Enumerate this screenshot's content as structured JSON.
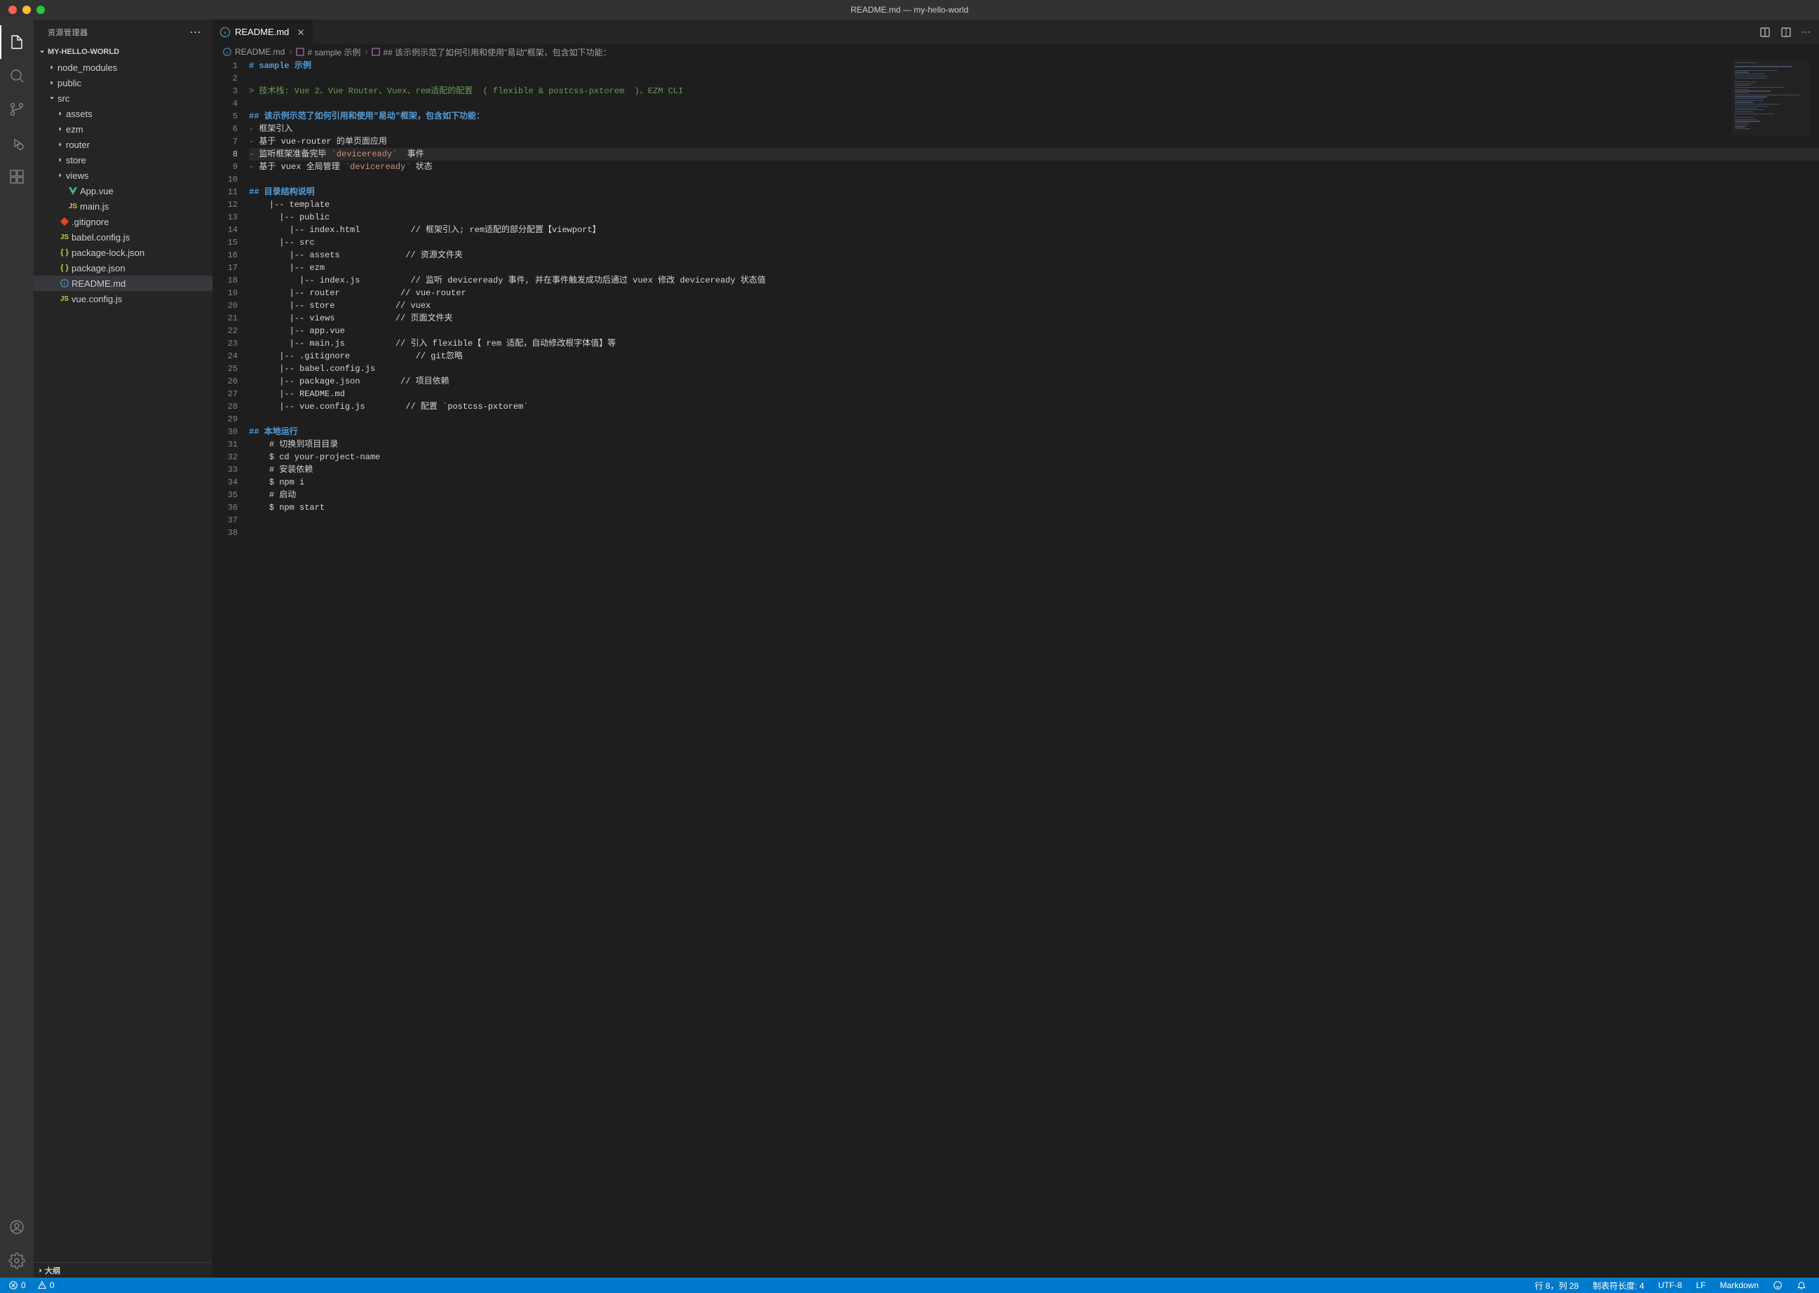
{
  "titlebar": {
    "title": "README.md — my-hello-world"
  },
  "sidebar": {
    "title": "资源管理器",
    "project": "MY-HELLO-WORLD",
    "outline": "大纲",
    "tree": [
      {
        "name": "node_modules",
        "type": "folder",
        "depth": 1,
        "expanded": false
      },
      {
        "name": "public",
        "type": "folder",
        "depth": 1,
        "expanded": false
      },
      {
        "name": "src",
        "type": "folder",
        "depth": 1,
        "expanded": true
      },
      {
        "name": "assets",
        "type": "folder",
        "depth": 2,
        "expanded": false
      },
      {
        "name": "ezm",
        "type": "folder",
        "depth": 2,
        "expanded": false
      },
      {
        "name": "router",
        "type": "folder",
        "depth": 2,
        "expanded": false
      },
      {
        "name": "store",
        "type": "folder",
        "depth": 2,
        "expanded": false
      },
      {
        "name": "views",
        "type": "folder",
        "depth": 2,
        "expanded": false
      },
      {
        "name": "App.vue",
        "type": "file",
        "depth": 2,
        "icon": "vue"
      },
      {
        "name": "main.js",
        "type": "file",
        "depth": 2,
        "icon": "js"
      },
      {
        "name": ".gitignore",
        "type": "file",
        "depth": 1,
        "icon": "git"
      },
      {
        "name": "babel.config.js",
        "type": "file",
        "depth": 1,
        "icon": "js"
      },
      {
        "name": "package-lock.json",
        "type": "file",
        "depth": 1,
        "icon": "json"
      },
      {
        "name": "package.json",
        "type": "file",
        "depth": 1,
        "icon": "json"
      },
      {
        "name": "README.md",
        "type": "file",
        "depth": 1,
        "icon": "info",
        "selected": true
      },
      {
        "name": "vue.config.js",
        "type": "file",
        "depth": 1,
        "icon": "js"
      }
    ]
  },
  "tabs": [
    {
      "label": "README.md",
      "icon": "info"
    }
  ],
  "breadcrumbs": [
    {
      "label": "README.md",
      "icon": "info"
    },
    {
      "label": "# sample 示例",
      "icon": "heading"
    },
    {
      "label": "## 该示例示范了如何引用和使用\"易动\"框架，包含如下功能：",
      "icon": "heading"
    }
  ],
  "editor": {
    "current_line": 8,
    "lines": [
      {
        "n": 1,
        "seg": [
          [
            "# ",
            "h"
          ],
          [
            "sample 示例",
            "h"
          ]
        ]
      },
      {
        "n": 2,
        "seg": []
      },
      {
        "n": 3,
        "seg": [
          [
            "> 技术栈: Vue 2、Vue Router、Vuex、rem适配的配置  ( flexible & postcss-pxtorem  )、EZM CLI",
            "quote"
          ]
        ]
      },
      {
        "n": 4,
        "seg": []
      },
      {
        "n": 5,
        "seg": [
          [
            "## 该示例示范了如何引用和使用\"易动\"框架，包含如下功能：",
            "h"
          ]
        ]
      },
      {
        "n": 6,
        "seg": [
          [
            "- ",
            "bullet"
          ],
          [
            "框架引入",
            "text"
          ]
        ]
      },
      {
        "n": 7,
        "seg": [
          [
            "- ",
            "bullet"
          ],
          [
            "基于 vue-router 的单页面应用",
            "text"
          ]
        ]
      },
      {
        "n": 8,
        "seg": [
          [
            "- ",
            "bullet"
          ],
          [
            "监听框架准备完毕 ",
            "text"
          ],
          [
            "`deviceready`",
            "code"
          ],
          [
            "  事件",
            "text"
          ]
        ]
      },
      {
        "n": 9,
        "seg": [
          [
            "- ",
            "bullet"
          ],
          [
            "基于 vuex 全局管理 ",
            "text"
          ],
          [
            "`deviceready`",
            "code"
          ],
          [
            " 状态",
            "text"
          ]
        ]
      },
      {
        "n": 10,
        "seg": []
      },
      {
        "n": 11,
        "seg": [
          [
            "## 目录结构说明",
            "h"
          ]
        ]
      },
      {
        "n": 12,
        "seg": [
          [
            "    |-- template",
            "text"
          ]
        ]
      },
      {
        "n": 13,
        "seg": [
          [
            "      |-- public",
            "text"
          ]
        ]
      },
      {
        "n": 14,
        "seg": [
          [
            "        |-- index.html          // 框架引入; rem适配的部分配置【viewport】",
            "text"
          ]
        ]
      },
      {
        "n": 15,
        "seg": [
          [
            "      |-- src",
            "text"
          ]
        ]
      },
      {
        "n": 16,
        "seg": [
          [
            "        |-- assets             // 资源文件夹",
            "text"
          ]
        ]
      },
      {
        "n": 17,
        "seg": [
          [
            "        |-- ezm",
            "text"
          ]
        ]
      },
      {
        "n": 18,
        "seg": [
          [
            "          |-- index.js          // 监听 deviceready 事件, 并在事件触发成功后通过 vuex 修改 deviceready 状态值",
            "text"
          ]
        ]
      },
      {
        "n": 19,
        "seg": [
          [
            "        |-- router            // vue-router",
            "text"
          ]
        ]
      },
      {
        "n": 20,
        "seg": [
          [
            "        |-- store            // vuex",
            "text"
          ]
        ]
      },
      {
        "n": 21,
        "seg": [
          [
            "        |-- views            // 页面文件夹",
            "text"
          ]
        ]
      },
      {
        "n": 22,
        "seg": [
          [
            "        |-- app.vue",
            "text"
          ]
        ]
      },
      {
        "n": 23,
        "seg": [
          [
            "        |-- main.js          // 引入 flexible【 rem 适配，自动修改根字体值】等",
            "text"
          ]
        ]
      },
      {
        "n": 24,
        "seg": [
          [
            "      |-- .gitignore             // git忽略",
            "text"
          ]
        ]
      },
      {
        "n": 25,
        "seg": [
          [
            "      |-- babel.config.js",
            "text"
          ]
        ]
      },
      {
        "n": 26,
        "seg": [
          [
            "      |-- package.json        // 项目依赖",
            "text"
          ]
        ]
      },
      {
        "n": 27,
        "seg": [
          [
            "      |-- README.md",
            "text"
          ]
        ]
      },
      {
        "n": 28,
        "seg": [
          [
            "      |-- vue.config.js        // 配置 `postcss-pxtorem`",
            "text"
          ]
        ]
      },
      {
        "n": 29,
        "seg": []
      },
      {
        "n": 30,
        "seg": [
          [
            "## 本地运行",
            "h"
          ]
        ]
      },
      {
        "n": 31,
        "seg": [
          [
            "    # 切换到项目目录",
            "text"
          ]
        ]
      },
      {
        "n": 32,
        "seg": [
          [
            "    $ cd your-project-name",
            "text"
          ]
        ]
      },
      {
        "n": 33,
        "seg": [
          [
            "    # 安装依赖",
            "text"
          ]
        ]
      },
      {
        "n": 34,
        "seg": [
          [
            "    $ npm i",
            "text"
          ]
        ]
      },
      {
        "n": 35,
        "seg": [
          [
            "    # 启动",
            "text"
          ]
        ]
      },
      {
        "n": 36,
        "seg": [
          [
            "    $ npm start",
            "text"
          ]
        ]
      },
      {
        "n": 37,
        "seg": []
      },
      {
        "n": 38,
        "seg": []
      }
    ]
  },
  "statusbar": {
    "errors": "0",
    "warnings": "0",
    "position": "行 8，列 28",
    "tab_size": "制表符长度: 4",
    "encoding": "UTF-8",
    "eol": "LF",
    "language": "Markdown"
  }
}
